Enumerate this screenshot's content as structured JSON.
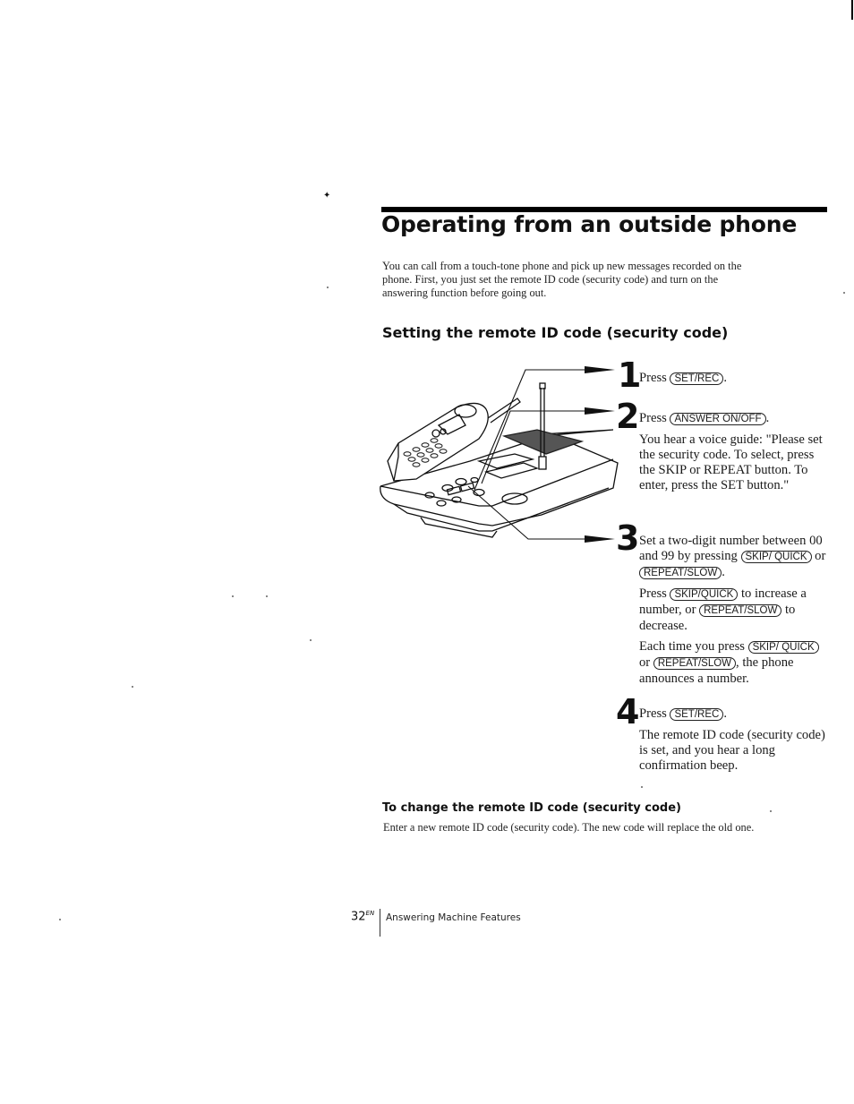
{
  "page": {
    "title": "Operating from an outside phone",
    "intro": "You can call from a touch-tone phone and pick up new messages recorded on the phone.  First, you just set the remote ID code (security code) and turn on the answering function before going out.",
    "section_heading": "Setting the remote ID code (security code)"
  },
  "figure": {
    "description": "Cordless telephone base unit with handset and antenna, with callout arrows",
    "callouts": [
      "1",
      "2",
      "3"
    ]
  },
  "steps": [
    {
      "number": "1",
      "lines": [
        {
          "pre": "Press ",
          "key": "SET/REC",
          "post": "."
        }
      ]
    },
    {
      "number": "2",
      "lines": [
        {
          "pre": "Press ",
          "key": "ANSWER ON/OFF",
          "post": "."
        }
      ],
      "note": "You hear a voice guide: \"Please set the security code. To select, press the SKIP or REPEAT button. To enter, press the SET button.\""
    },
    {
      "number": "3",
      "para1": {
        "pre": "Set a two-digit number between 00 and 99 by pressing ",
        "key1": "SKIP/ QUICK",
        "mid": " or ",
        "key2": "REPEAT/SLOW",
        "post": "."
      },
      "para2": {
        "pre": "Press ",
        "key1": "SKIP/QUICK",
        "mid": " to increase a number, or ",
        "key2": "REPEAT/SLOW",
        "post": " to decrease."
      },
      "para3": {
        "pre": "Each time you press ",
        "key1": "SKIP/ QUICK",
        "mid": " or ",
        "key2": "REPEAT/SLOW",
        "post": ", the phone announces a number."
      }
    },
    {
      "number": "4",
      "lines": [
        {
          "pre": "Press ",
          "key": "SET/REC",
          "post": "."
        }
      ],
      "note": "The remote ID code (security code) is set, and you hear a long confirmation beep."
    }
  ],
  "change_section": {
    "heading": "To change the remote ID code (security code)",
    "text": "Enter a new remote ID code (security code).  The new code will replace the old one."
  },
  "footer": {
    "page_number": "32",
    "page_suffix": "EN",
    "section": "Answering Machine Features"
  }
}
